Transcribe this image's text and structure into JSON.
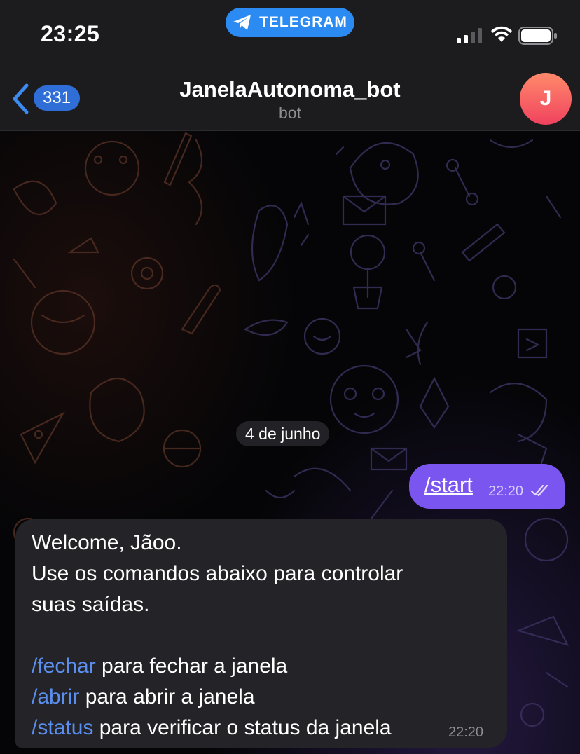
{
  "status_bar": {
    "time": "23:25",
    "app_pill": "TELEGRAM"
  },
  "header": {
    "back_count": "331",
    "title": "JanelaAutonoma_bot",
    "subtitle": "bot",
    "avatar_letter": "J"
  },
  "chat": {
    "date_chip": "4 de junho",
    "messages": [
      {
        "direction": "outgoing",
        "text": "/start",
        "time": "22:20",
        "status": "read"
      },
      {
        "direction": "incoming",
        "lines": [
          "Welcome, Jãoo.",
          "Use os comandos abaixo para controlar",
          "suas saídas."
        ],
        "commands": [
          {
            "command": "/fechar",
            "description": " para fechar a janela"
          },
          {
            "command": "/abrir",
            "description": " para abrir a janela"
          },
          {
            "command": "/status",
            "description": " para verificar o status da janela"
          }
        ],
        "time": "22:20"
      }
    ]
  },
  "colors": {
    "accent": "#2b8bf2",
    "outgoing_bubble": "#7b55f0",
    "incoming_bubble": "#242428",
    "command_link": "#5a8ff0"
  },
  "icons": [
    "telegram-plane-icon",
    "cellular-signal-icon",
    "wifi-icon",
    "battery-icon",
    "chevron-left-icon",
    "double-check-icon"
  ]
}
